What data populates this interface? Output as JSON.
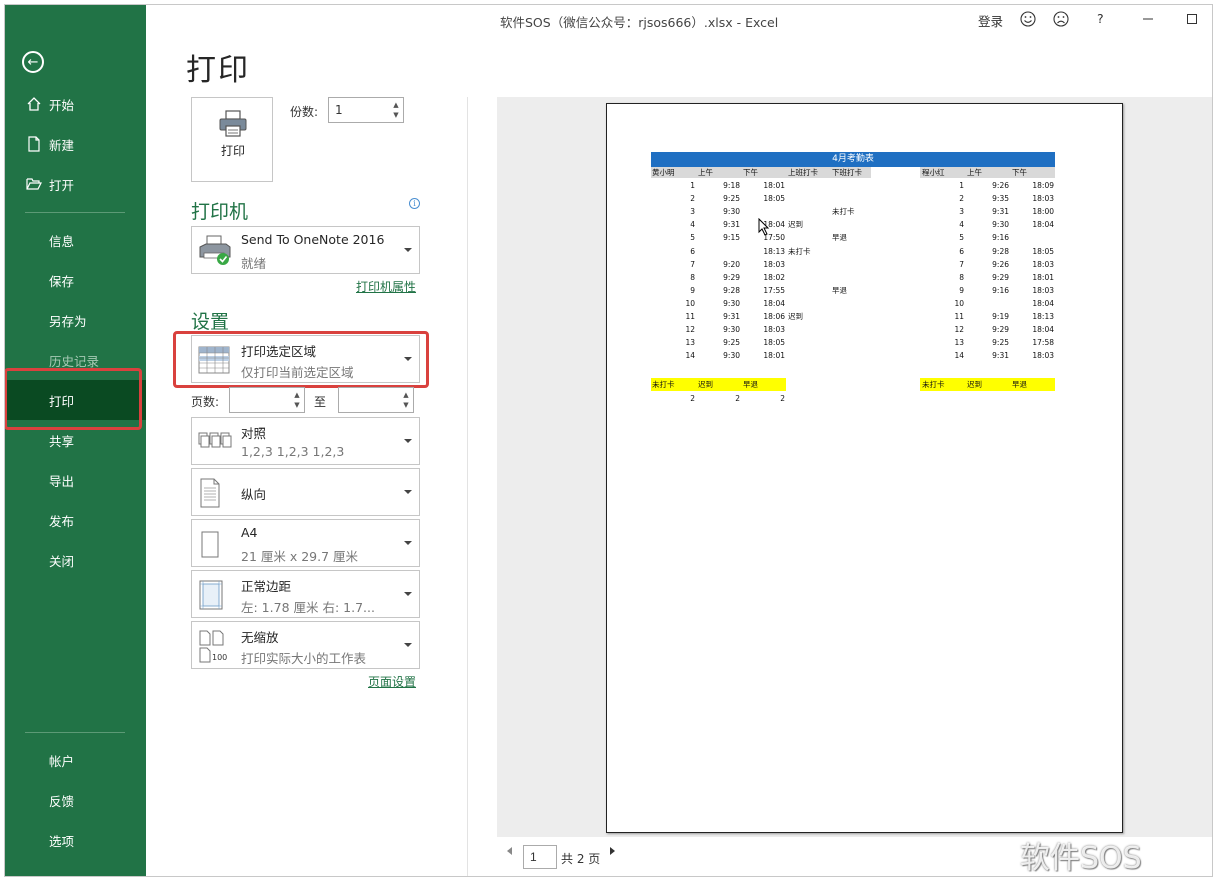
{
  "window": {
    "title": "软件SOS（微信公众号：rjsos666）.xlsx  -  Excel",
    "signin": "登录",
    "help": "?"
  },
  "sidebar": {
    "items": [
      {
        "label": "开始",
        "icon": "home-icon"
      },
      {
        "label": "新建",
        "icon": "new-doc-icon"
      },
      {
        "label": "打开",
        "icon": "open-folder-icon"
      },
      {
        "label": "信息"
      },
      {
        "label": "保存"
      },
      {
        "label": "另存为"
      },
      {
        "label": "历史记录",
        "disabled": true
      },
      {
        "label": "打印",
        "active": true
      },
      {
        "label": "共享"
      },
      {
        "label": "导出"
      },
      {
        "label": "发布"
      },
      {
        "label": "关闭"
      },
      {
        "label": "帐户"
      },
      {
        "label": "反馈"
      },
      {
        "label": "选项"
      }
    ],
    "colors": {
      "bg": "#217346",
      "active": "#0a4a22",
      "highlight": "#d9413e"
    }
  },
  "print": {
    "title": "打印",
    "button_label": "打印",
    "copies_label": "份数:",
    "copies_value": "1",
    "printer_heading": "打印机",
    "printer_name": "Send To OneNote 2016",
    "printer_status": "就绪",
    "printer_props_link": "打印机属性",
    "settings_heading": "设置",
    "area": {
      "title": "打印选定区域",
      "desc": "仅打印当前选定区域"
    },
    "pages_label": "页数:",
    "to_label": "至",
    "collate": {
      "title": "对照",
      "desc": "1,2,3    1,2,3    1,2,3"
    },
    "orientation": {
      "title": "纵向"
    },
    "paper": {
      "title": "A4",
      "desc": "21 厘米 x 29.7 厘米"
    },
    "margins": {
      "title": "正常边距",
      "desc": "左:  1.78 厘米     右:  1.7..."
    },
    "scaling": {
      "title": "无缩放",
      "desc": "打印实际大小的工作表"
    },
    "page_setup_link": "页面设置"
  },
  "preview": {
    "sheet_title": "4月考勤表",
    "headers_left": [
      "黄小明",
      "上午",
      "下午",
      "上班打卡",
      "下班打卡"
    ],
    "headers_right": [
      "程小红",
      "上午",
      "下午"
    ],
    "rows_left": [
      [
        "1",
        "9:18",
        "18:01",
        "",
        ""
      ],
      [
        "2",
        "9:25",
        "18:05",
        "",
        ""
      ],
      [
        "3",
        "9:30",
        "",
        "",
        "未打卡"
      ],
      [
        "4",
        "9:31",
        "18:04",
        "迟到",
        ""
      ],
      [
        "5",
        "9:15",
        "17:50",
        "",
        "早退"
      ],
      [
        "6",
        "",
        "18:13",
        "未打卡",
        ""
      ],
      [
        "7",
        "9:20",
        "18:03",
        "",
        ""
      ],
      [
        "8",
        "9:29",
        "18:02",
        "",
        ""
      ],
      [
        "9",
        "9:28",
        "17:55",
        "",
        "早退"
      ],
      [
        "10",
        "9:30",
        "18:04",
        "",
        ""
      ],
      [
        "11",
        "9:31",
        "18:06",
        "迟到",
        ""
      ],
      [
        "12",
        "9:30",
        "18:03",
        "",
        ""
      ],
      [
        "13",
        "9:25",
        "18:05",
        "",
        ""
      ],
      [
        "14",
        "9:30",
        "18:01",
        "",
        ""
      ]
    ],
    "rows_right": [
      [
        "1",
        "9:26",
        "18:09"
      ],
      [
        "2",
        "9:35",
        "18:03"
      ],
      [
        "3",
        "9:31",
        "18:00"
      ],
      [
        "4",
        "9:30",
        "18:04"
      ],
      [
        "5",
        "9:16",
        ""
      ],
      [
        "6",
        "9:28",
        "18:05"
      ],
      [
        "7",
        "9:26",
        "18:03"
      ],
      [
        "8",
        "9:29",
        "18:01"
      ],
      [
        "9",
        "9:16",
        "18:03"
      ],
      [
        "10",
        "",
        "18:04"
      ],
      [
        "11",
        "9:19",
        "18:13"
      ],
      [
        "12",
        "9:29",
        "18:04"
      ],
      [
        "13",
        "9:25",
        "17:58"
      ],
      [
        "14",
        "9:31",
        "18:03"
      ]
    ],
    "summary_labels": [
      "未打卡",
      "迟到",
      "早退"
    ],
    "summary_values_left": [
      "2",
      "2",
      "2"
    ],
    "page_current": "1",
    "page_total": "共 2 页",
    "colors": {
      "title_fill": "#1f6fc2",
      "header_fill": "#d9d9d9",
      "summary_fill": "#ffff00"
    }
  },
  "watermark": "软件SOS"
}
